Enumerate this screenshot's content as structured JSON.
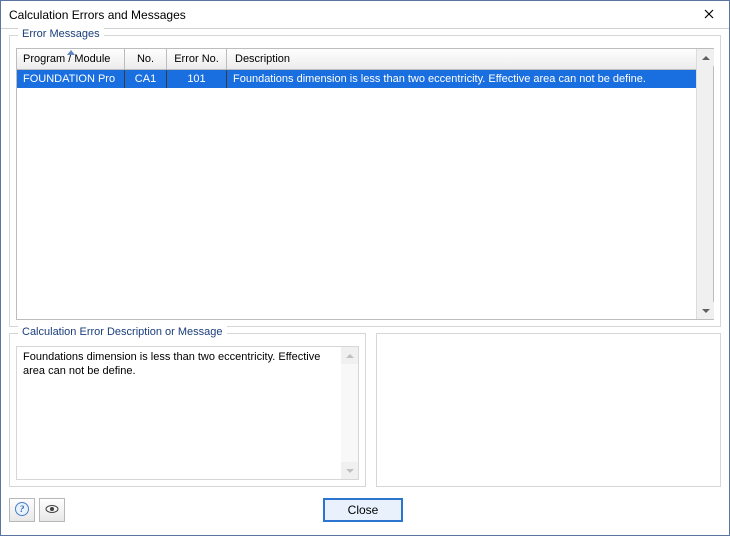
{
  "window": {
    "title": "Calculation Errors and Messages"
  },
  "errors_group": {
    "legend": "Error Messages",
    "headers": {
      "program": "Program / Module",
      "no": "No.",
      "error_no": "Error No.",
      "description": "Description"
    },
    "rows": [
      {
        "program": "FOUNDATION Pro",
        "no": "CA1",
        "error_no": "101",
        "description": "Foundations dimension is less than two eccentricity. Effective area can not be define."
      }
    ]
  },
  "desc_group": {
    "legend": "Calculation Error Description or Message",
    "text": "Foundations dimension is less than two eccentricity. Effective area can not be define."
  },
  "footer": {
    "close": "Close"
  },
  "icons": {
    "help": "help-icon",
    "eye": "eye-icon",
    "close": "close-icon"
  }
}
